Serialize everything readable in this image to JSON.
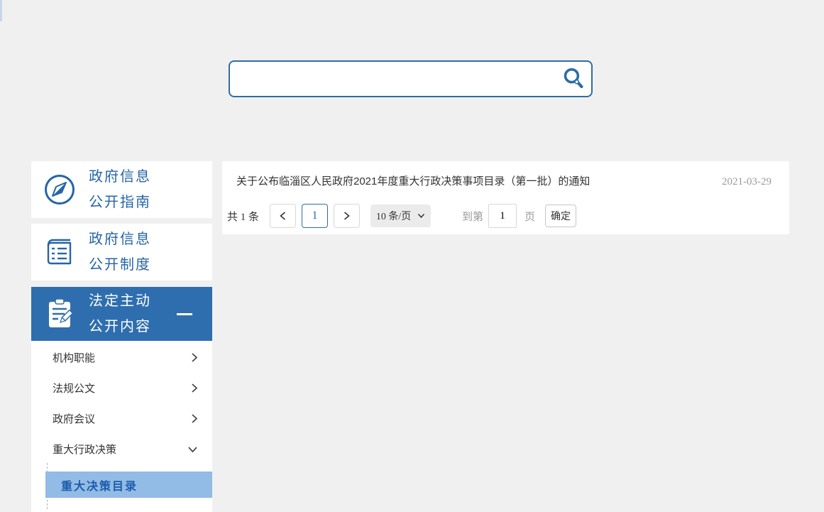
{
  "page": {
    "background_color": "#f0f0f1",
    "accent_color": "#2e6da4"
  },
  "search": {
    "value": "",
    "placeholder": "",
    "icon": "search-magnifier-key-icon"
  },
  "sidebar": {
    "cards": [
      {
        "line1": "政府信息",
        "line2": "公开指南",
        "icon": "compass-icon",
        "active": false
      },
      {
        "line1": "政府信息",
        "line2": "公开制度",
        "icon": "notebook-icon",
        "active": false
      },
      {
        "line1": "法定主动",
        "line2": "公开内容",
        "icon": "clipboard-pencil-icon",
        "active": true,
        "collapse_icon": "minus-icon"
      }
    ],
    "submenu": {
      "items": [
        {
          "label": "机构职能",
          "state_icon": "chevron-right-icon",
          "expanded": false
        },
        {
          "label": "法规公文",
          "state_icon": "chevron-right-icon",
          "expanded": false
        },
        {
          "label": "政府会议",
          "state_icon": "chevron-right-icon",
          "expanded": false
        },
        {
          "label": "重大行政决策",
          "state_icon": "chevron-down-icon",
          "expanded": true
        }
      ],
      "active_leaf": {
        "label": "重大决策目录",
        "highlight_color": "#92bbe5",
        "text_color": "#1b5cab"
      }
    }
  },
  "content": {
    "list": [
      {
        "title": "关于公布临淄区人民政府2021年度重大行政决策事项目录（第一批）的通知",
        "date": "2021-03-29"
      }
    ],
    "pagination": {
      "total": "共 1 条",
      "prev_icon": "chevron-left-icon",
      "current_page": "1",
      "next_icon": "chevron-right-icon",
      "page_size": "10 条/页",
      "page_size_icon": "chevron-down-icon",
      "goto_label": "到第",
      "goto_value": "1",
      "goto_unit": "页",
      "confirm_label": "确定"
    }
  }
}
